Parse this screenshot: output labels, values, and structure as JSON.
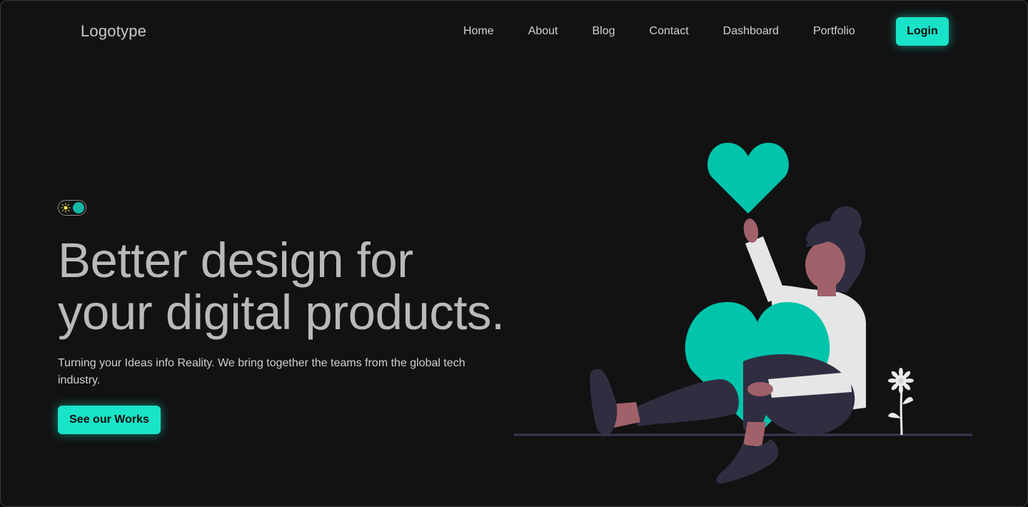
{
  "header": {
    "logo": "Logotype",
    "nav": [
      "Home",
      "About",
      "Blog",
      "Contact",
      "Dashboard",
      "Portfolio"
    ],
    "login_label": "Login"
  },
  "hero": {
    "theme_toggle": {
      "state": "dark",
      "icon": "sun-icon"
    },
    "headline_line1": "Better design for",
    "headline_line2": "your digital products.",
    "subtitle": "Turning your Ideas info Reality. We bring together the teams from the global tech industry.",
    "cta_label": "See our Works"
  },
  "colors": {
    "background": "#121213",
    "accent": "#19e3c8",
    "heading": "#b9b9b9",
    "text": "#d0d0d0"
  }
}
